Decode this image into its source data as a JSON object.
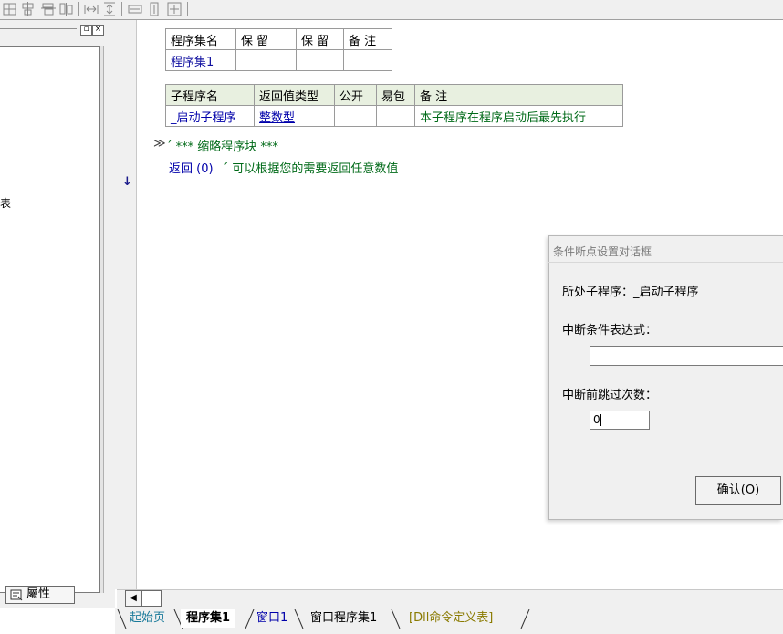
{
  "toolbar": {
    "icons": [
      "align-left-icon",
      "align-center-icon",
      "align-right-icon",
      "align-justify-icon",
      "space-horizontal-icon",
      "space-vertical-icon",
      "same-width-icon",
      "same-height-icon",
      "same-size-icon"
    ]
  },
  "left_panel": {
    "minimize_glyph": "▫",
    "close_glyph": "×",
    "cut_text": "表",
    "properties_tab": "屬性"
  },
  "assembly_table": {
    "headers": [
      "程序集名",
      "保 留",
      "保 留",
      "备 注"
    ],
    "row": [
      "程序集1",
      "",
      "",
      ""
    ]
  },
  "sub_table": {
    "headers": [
      "子程序名",
      "返回值类型",
      "公开",
      "易包",
      "备 注"
    ],
    "row": [
      "_启动子程序",
      "整数型",
      "",
      "",
      "本子程序在程序启动后最先执行"
    ]
  },
  "code": {
    "fold_marker": "≫",
    "line1": "´ *** 缩略程序块 ***",
    "line2_kw": "返回 (0)",
    "line2_comment": "´ 可以根据您的需要返回任意数值",
    "current_line_arrow": "↓"
  },
  "dialog": {
    "title": "条件断点设置对话框",
    "subprogram_label": "所处子程序：",
    "subprogram_value": "_启动子程序",
    "condition_label": "中断条件表达式：",
    "condition_value": "",
    "skip_label": "中断前跳过次数：",
    "skip_value": "0",
    "confirm_label": "确认(O)"
  },
  "scrollbar": {
    "left_arrow": "◀"
  },
  "tabs": [
    "起始页",
    "程序集1",
    "窗口1",
    "窗口程序集1",
    "[Dll命令定义表]"
  ],
  "colors": {
    "tab_start": "#1a7a9a",
    "tab_dll": "#8a7a00",
    "green_text": "#006a18",
    "blue_text": "#1010a0"
  }
}
